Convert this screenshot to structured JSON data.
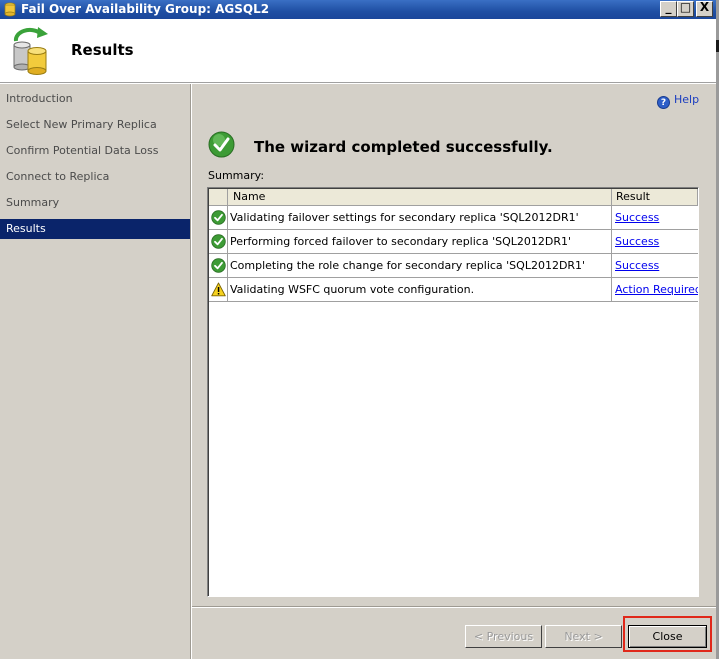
{
  "window": {
    "title": "Fail Over Availability Group: AGSQL2",
    "minimize_glyph": "_",
    "maximize_glyph": "□",
    "close_glyph": "X"
  },
  "header": {
    "page_title": "Results"
  },
  "sidebar": {
    "items": [
      {
        "label": "Introduction",
        "active": false
      },
      {
        "label": "Select New Primary Replica",
        "active": false
      },
      {
        "label": "Confirm Potential Data Loss",
        "active": false
      },
      {
        "label": "Connect to Replica",
        "active": false
      },
      {
        "label": "Summary",
        "active": false
      },
      {
        "label": "Results",
        "active": true
      }
    ]
  },
  "main": {
    "help_label": "Help",
    "headline": "The wizard completed successfully.",
    "summary_label": "Summary:",
    "table": {
      "columns": [
        "Name",
        "Result"
      ],
      "rows": [
        {
          "status_icon": "success-icon",
          "name": "Validating failover settings for secondary replica 'SQL2012DR1'",
          "result": "Success"
        },
        {
          "status_icon": "success-icon",
          "name": "Performing forced failover to secondary replica 'SQL2012DR1'",
          "result": "Success"
        },
        {
          "status_icon": "success-icon",
          "name": "Completing the role change for secondary replica 'SQL2012DR1'",
          "result": "Success"
        },
        {
          "status_icon": "warning-icon",
          "name": "Validating WSFC quorum vote configuration.",
          "result": "Action Required"
        }
      ]
    }
  },
  "footer": {
    "previous_label": "< Previous",
    "next_label": "Next >",
    "close_label": "Close"
  },
  "colors": {
    "title_bar": "#1f4fa3",
    "selected_nav": "#0a246a",
    "link": "#0000ee",
    "highlight": "#e0281a"
  }
}
